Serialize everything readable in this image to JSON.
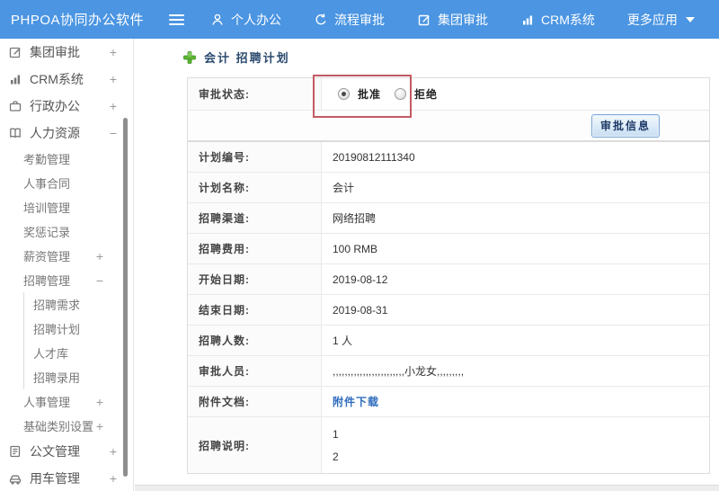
{
  "colors": {
    "header_bg": "#4b95e2",
    "annotation_red": "#c25a62",
    "link_blue": "#2e6cbd",
    "plus_green": "#5cb432",
    "button_border": "#7ba8d9"
  },
  "header": {
    "logo": "PHPOA协同办公软件",
    "nav": [
      {
        "label": "个人办公",
        "icon": "person-icon"
      },
      {
        "label": "流程审批",
        "icon": "process-icon"
      },
      {
        "label": "集团审批",
        "icon": "edit-icon"
      },
      {
        "label": "CRM系统",
        "icon": "chart-icon"
      },
      {
        "label": "更多应用",
        "icon": "caret-down-icon"
      }
    ]
  },
  "sidebar": {
    "items": [
      {
        "label": "集团审批",
        "icon": "edit-icon",
        "expander": "+"
      },
      {
        "label": "CRM系统",
        "icon": "chart-icon",
        "expander": "+"
      },
      {
        "label": "行政办公",
        "icon": "briefcase-icon",
        "expander": "+"
      },
      {
        "label": "人力资源",
        "icon": "book-icon",
        "expander": "−",
        "children": [
          {
            "label": "考勤管理",
            "expander": ""
          },
          {
            "label": "人事合同",
            "expander": ""
          },
          {
            "label": "培训管理",
            "expander": ""
          },
          {
            "label": "奖惩记录",
            "expander": ""
          },
          {
            "label": "薪资管理",
            "expander": "+"
          },
          {
            "label": "招聘管理",
            "expander": "−",
            "children": [
              {
                "label": "招聘需求"
              },
              {
                "label": "招聘计划"
              },
              {
                "label": "人才库"
              },
              {
                "label": "招聘录用"
              }
            ]
          },
          {
            "label": "人事管理",
            "expander": "+"
          },
          {
            "label": "基础类别设置",
            "expander": "+"
          }
        ]
      },
      {
        "label": "公文管理",
        "icon": "doc-icon",
        "expander": "+"
      },
      {
        "label": "用车管理",
        "icon": "car-icon",
        "expander": "+"
      }
    ]
  },
  "main": {
    "title": "会计 招聘计划",
    "approval": {
      "status_label": "审批状态:",
      "approve_label": "批准",
      "reject_label": "拒绝",
      "selected": "批准",
      "info_button_label": "审批信息"
    },
    "fields": [
      {
        "label": "计划编号:",
        "value": "20190812111340"
      },
      {
        "label": "计划名称:",
        "value": "会计"
      },
      {
        "label": "招聘渠道:",
        "value": "网络招聘"
      },
      {
        "label": "招聘费用:",
        "value": "100 RMB"
      },
      {
        "label": "开始日期:",
        "value": "2019-08-12"
      },
      {
        "label": "结束日期:",
        "value": "2019-08-31"
      },
      {
        "label": "招聘人数:",
        "value": "1 人"
      },
      {
        "label": "审批人员:",
        "value": ",,,,,,,,,,,,,,,,,,,,,,,,小龙女,,,,,,,,,"
      },
      {
        "label": "附件文档:",
        "value": "附件下载"
      }
    ],
    "description": {
      "label": "招聘说明:",
      "line1": "1",
      "line2": "2"
    }
  }
}
